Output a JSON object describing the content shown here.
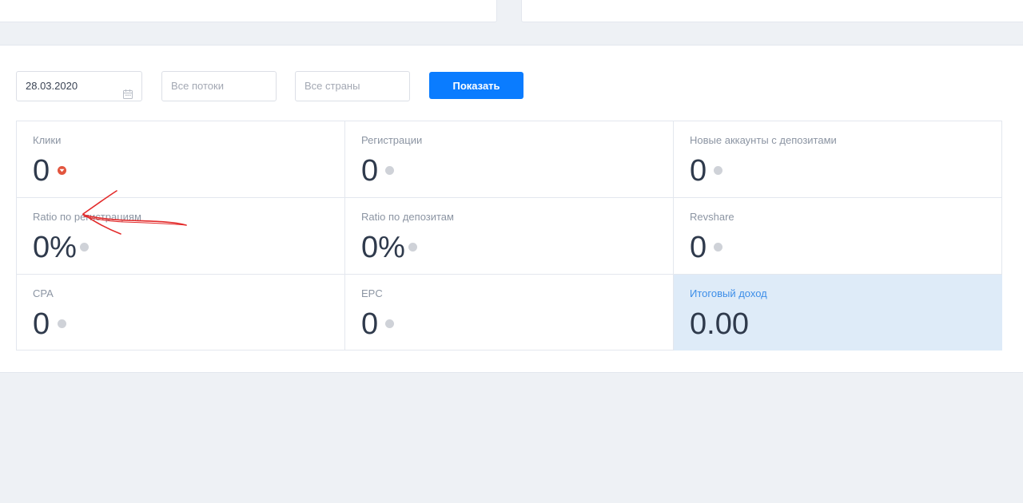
{
  "filters": {
    "date_value": "28.03.2020",
    "streams_placeholder": "Все потоки",
    "countries_placeholder": "Все страны",
    "show_button": "Показать"
  },
  "stats": {
    "clicks": {
      "label": "Клики",
      "value": "0",
      "trend": "down"
    },
    "registrations": {
      "label": "Регистрации",
      "value": "0"
    },
    "new_deposit_accounts": {
      "label": "Новые аккаунты с депозитами",
      "value": "0"
    },
    "ratio_registrations": {
      "label": "Ratio по регистрациям",
      "value": "0%"
    },
    "ratio_deposits": {
      "label": "Ratio по депозитам",
      "value": "0%"
    },
    "revshare": {
      "label": "Revshare",
      "value": "0"
    },
    "cpa": {
      "label": "CPA",
      "value": "0"
    },
    "epc": {
      "label": "EPC",
      "value": "0"
    },
    "total_income": {
      "label": "Итоговый доход",
      "value": "0.00"
    }
  },
  "colors": {
    "accent": "#0a7cff",
    "trend_down": "#e2553e",
    "annotation": "#e32a2a",
    "total_bg": "#deebf8"
  },
  "icons": {
    "date_field": "calendar-icon",
    "clicks_trend": "caret-down-icon",
    "annotation": "hand-drawn-arrow-icon"
  }
}
